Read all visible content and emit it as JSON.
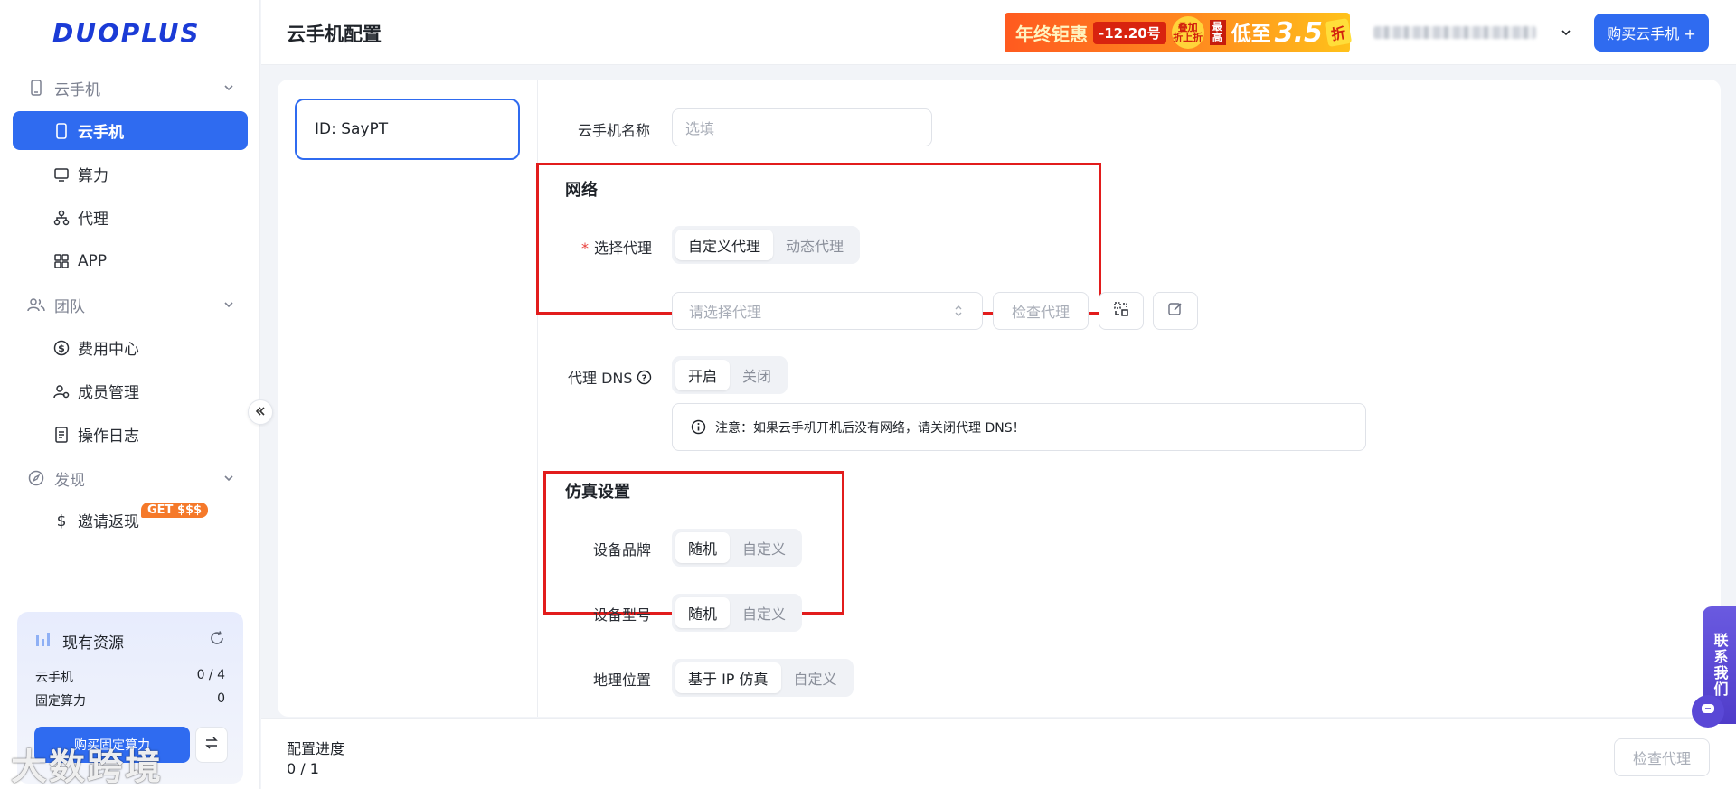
{
  "logo": {
    "text": "DUOPLUS"
  },
  "sidebar": {
    "groups": [
      {
        "label": "云手机",
        "icon": "phone-outline-icon"
      },
      {
        "label": "团队",
        "icon": "team-icon"
      },
      {
        "label": "发现",
        "icon": "compass-icon"
      }
    ],
    "items": [
      {
        "label": "云手机",
        "icon": "phone-icon",
        "active": true
      },
      {
        "label": "算力",
        "icon": "monitor-icon"
      },
      {
        "label": "代理",
        "icon": "network-icon"
      },
      {
        "label": "APP",
        "icon": "grid-icon"
      },
      {
        "label": "费用中心",
        "icon": "dollar-circle-icon"
      },
      {
        "label": "成员管理",
        "icon": "user-manage-icon"
      },
      {
        "label": "操作日志",
        "icon": "log-icon"
      },
      {
        "label": "邀请返现",
        "icon": "dollar-icon"
      }
    ],
    "invite_badge": "GET $$$",
    "resources": {
      "title": "现有资源",
      "rows": [
        {
          "label": "云手机",
          "value": "0 / 4"
        },
        {
          "label": "固定算力",
          "value": "0"
        }
      ],
      "buy_label": "购买固定算力"
    },
    "watermark": "大数跨境"
  },
  "header": {
    "title": "云手机配置",
    "promo": {
      "text1": "年终钜惠",
      "text2": "-12.20号",
      "text3": "叠加 折上折",
      "text4": "最高",
      "text5": "低至",
      "text6": "3.5",
      "text7": "折"
    },
    "buy_button": "购买云手机 +"
  },
  "form": {
    "id_card": "ID: SayPT",
    "name_label": "云手机名称",
    "name_placeholder": "选填",
    "network_title": "网络",
    "proxy_label": "选择代理",
    "proxy_options": [
      "自定义代理",
      "动态代理"
    ],
    "proxy_select_placeholder": "请选择代理",
    "check_proxy": "检查代理",
    "dns_label": "代理 DNS",
    "dns_options": [
      "开启",
      "关闭"
    ],
    "notice": "注意：如果云手机开机后没有网络，请关闭代理 DNS！",
    "sim_title": "仿真设置",
    "brand_label": "设备品牌",
    "brand_options": [
      "随机",
      "自定义"
    ],
    "model_label": "设备型号",
    "model_options": [
      "随机",
      "自定义"
    ],
    "geo_label": "地理位置",
    "geo_options": [
      "基于 IP 仿真",
      "自定义"
    ]
  },
  "footer": {
    "progress_label": "配置进度",
    "progress_value": "0 / 1",
    "check_proxy": "检查代理"
  },
  "contact": {
    "label": "联系我们"
  },
  "colors": {
    "primary": "#2f6bf0",
    "highlight": "#e21c1c",
    "contact": "#5a48d6"
  }
}
